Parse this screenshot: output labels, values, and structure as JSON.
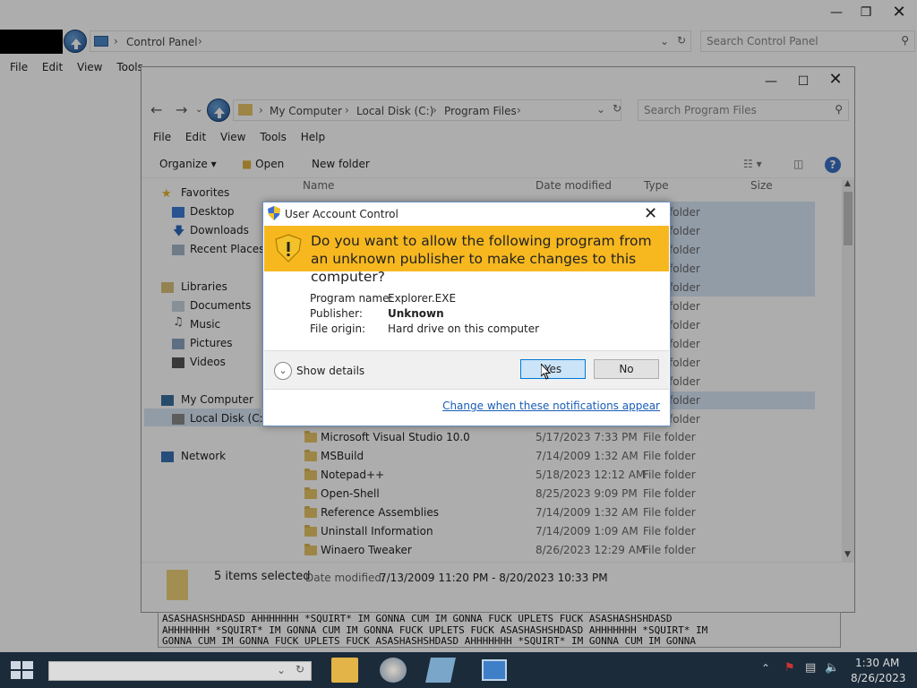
{
  "back_window": {
    "breadcrumb": [
      "Control Panel"
    ],
    "search_placeholder": "Search Control Panel",
    "menu": [
      "File",
      "Edit",
      "View",
      "Tools"
    ]
  },
  "explorer": {
    "breadcrumb": [
      "My Computer",
      "Local Disk (C:)",
      "Program Files"
    ],
    "search_placeholder": "Search Program Files",
    "menu": [
      "File",
      "Edit",
      "View",
      "Tools",
      "Help"
    ],
    "toolbar": {
      "organize": "Organize",
      "open": "Open",
      "new_folder": "New folder"
    },
    "columns": {
      "name": "Name",
      "date": "Date modified",
      "type": "Type",
      "size": "Size"
    },
    "nav": {
      "favorites": "Favorites",
      "desktop": "Desktop",
      "downloads": "Downloads",
      "recent": "Recent Places",
      "libraries": "Libraries",
      "documents": "Documents",
      "music": "Music",
      "pictures": "Pictures",
      "videos": "Videos",
      "computer": "My Computer",
      "localdisk": "Local Disk (C:)",
      "network": "Network"
    },
    "partial_types": [
      "folder",
      "folder",
      "folder",
      "folder",
      "folder",
      "folder",
      "folder",
      "folder",
      "folder",
      "folder",
      "folder",
      "folder"
    ],
    "rows": [
      {
        "name": "Microsoft Visual Studio 10.0",
        "date": "5/17/2023 7:33 PM",
        "type": "File folder"
      },
      {
        "name": "MSBuild",
        "date": "7/14/2009 1:32 AM",
        "type": "File folder"
      },
      {
        "name": "Notepad++",
        "date": "5/18/2023 12:12 AM",
        "type": "File folder"
      },
      {
        "name": "Open-Shell",
        "date": "8/25/2023 9:09 PM",
        "type": "File folder"
      },
      {
        "name": "Reference Assemblies",
        "date": "7/14/2009 1:32 AM",
        "type": "File folder"
      },
      {
        "name": "Uninstall Information",
        "date": "7/14/2009 1:09 AM",
        "type": "File folder"
      },
      {
        "name": "Winaero Tweaker",
        "date": "8/26/2023 12:29 AM",
        "type": "File folder"
      }
    ],
    "details": {
      "selected": "5 items selected",
      "date_label": "Date modified:",
      "date_range": "7/13/2009 11:20 PM - 8/20/2023 10:33 PM"
    }
  },
  "textarea_lines": [
    "ASASHASHSHDASD AHHHHHHH *SQUIRT* IM GONNA CUM IM GONNA FUCK UPLETS FUCK ASASHASHSHDASD",
    "AHHHHHHH *SQUIRT* IM GONNA CUM IM GONNA FUCK UPLETS FUCK ASASHASHSHDASD AHHHHHHH *SQUIRT* IM",
    "GONNA CUM IM GONNA FUCK UPLETS FUCK ASASHASHSHDASD AHHHHHHH *SQUIRT* IM GONNA CUM IM GONNA"
  ],
  "uac": {
    "title": "User Account Control",
    "question": "Do you want to allow the following program from an unknown publisher to make changes to this computer?",
    "program_label": "Program name:",
    "program_value": "Explorer.EXE",
    "publisher_label": "Publisher:",
    "publisher_value": "Unknown",
    "origin_label": "File origin:",
    "origin_value": "Hard drive on this computer",
    "show_details": "Show details",
    "yes": "Yes",
    "no": "No",
    "link": "Change when these notifications appear",
    "band_color": "#f7b81f"
  },
  "taskbar": {
    "time": "1:30 AM",
    "date": "8/26/2023"
  }
}
